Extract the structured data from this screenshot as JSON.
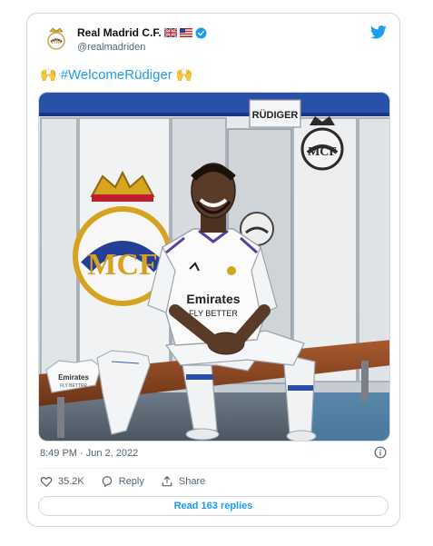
{
  "tweet": {
    "author_name": "Real Madrid C.F.",
    "handle": "@realmadriden",
    "hashtag": "#WelcomeRüdiger",
    "emoji_left": "🙌",
    "emoji_right": "🙌",
    "timestamp": "8:49 PM · Jun 2, 2022",
    "likes": "35.2K",
    "reply_label": "Reply",
    "share_label": "Share",
    "read_replies": "Read 163 replies"
  },
  "photo": {
    "nameplate": "RÜDIGER",
    "shirt_sponsor_line1": "Emirates",
    "shirt_sponsor_line2": "FLY BETTER",
    "folded_shirt_line1": "Emirates",
    "folded_shirt_line2": "FLY BETTER"
  },
  "colors": {
    "link_blue": "#1d9bf0",
    "text_dark": "#0f1419",
    "text_gray": "#536471",
    "border": "#cfd9de"
  }
}
